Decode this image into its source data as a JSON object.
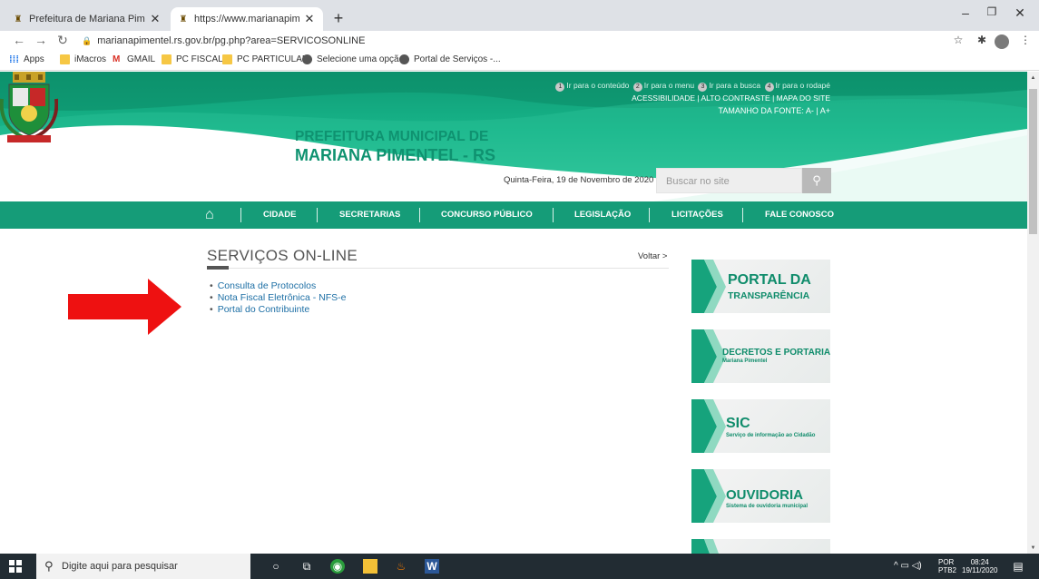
{
  "browser": {
    "tabs": [
      {
        "title": "Prefeitura de Mariana Pimentel -",
        "active": false
      },
      {
        "title": "https://www.marianapimentel.rs.g",
        "active": true
      }
    ],
    "new_tab_label": "+",
    "url": "marianapimentel.rs.gov.br/pg.php?area=SERVICOSONLINE",
    "bookmarks": [
      "Apps",
      "iMacros",
      "GMAIL",
      "PC FISCAL",
      "PC PARTICULAR",
      "Selecione uma opção",
      "Portal de Serviços -..."
    ]
  },
  "site": {
    "accessibility": {
      "skip_1": "Ir para o conteúdo",
      "skip_2": "Ir para o menu",
      "skip_3": "Ir para a busca",
      "skip_4": "Ir para o rodapé",
      "links": "ACESSIBILIDADE | ALTO CONTRASTE | MAPA DO SITE",
      "font_label": "TAMANHO DA FONTE:",
      "font_controls": "A- | A+"
    },
    "brand_line1": "PREFEITURA MUNICIPAL DE",
    "brand_line2": "MARIANA PIMENTEL - RS",
    "date": "Quinta-Feira, 19 de Novembro de 2020",
    "search_placeholder": "Buscar no site",
    "nav": [
      "CIDADE",
      "SECRETARIAS",
      "CONCURSO PÚBLICO",
      "LEGISLAÇÃO",
      "LICITAÇÕES",
      "FALE CONOSCO"
    ],
    "section_title": "SERVIÇOS ON-LINE",
    "back_link": "Voltar >",
    "services": [
      "Consulta de Protocolos",
      "Nota Fiscal Eletrônica - NFS-e",
      "Portal do Contribuinte"
    ],
    "banners": [
      {
        "title": "PORTAL DA",
        "subtitle": "TRANSPARÊNCIA"
      },
      {
        "title": "DECRETOS E PORTARIAS",
        "subtitle": "Mariana Pimentel"
      },
      {
        "title": "SIC",
        "subtitle": "Serviço de informação ao Cidadão"
      },
      {
        "title": "OUVIDORIA",
        "subtitle": "Sistema de ouvidoria municipal"
      }
    ]
  },
  "taskbar": {
    "search_placeholder": "Digite aqui para pesquisar",
    "lang": "POR",
    "lang_sub": "PTB2",
    "time": "08:24",
    "date": "19/11/2020"
  },
  "colors": {
    "brand_green": "#159c78",
    "link_blue": "#1d6fa5",
    "arrow_red": "#ee1111"
  }
}
